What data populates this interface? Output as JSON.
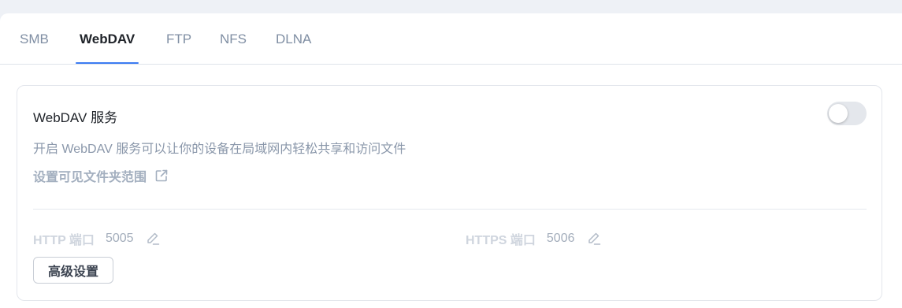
{
  "tabs": [
    {
      "label": "SMB",
      "active": false
    },
    {
      "label": "WebDAV",
      "active": true
    },
    {
      "label": "FTP",
      "active": false
    },
    {
      "label": "NFS",
      "active": false
    },
    {
      "label": "DLNA",
      "active": false
    }
  ],
  "service": {
    "title": "WebDAV 服务",
    "description": "开启 WebDAV 服务可以让你的设备在局域网内轻松共享和访问文件",
    "scope_link": "设置可见文件夹范围",
    "enabled": false
  },
  "ports": {
    "http_label": "HTTP 端口",
    "http_value": "5005",
    "https_label": "HTTPS 端口",
    "https_value": "5006"
  },
  "advanced_button": "高级设置",
  "colors": {
    "accent": "#3c7bf2",
    "toggle_off": "#e4e7ec"
  }
}
